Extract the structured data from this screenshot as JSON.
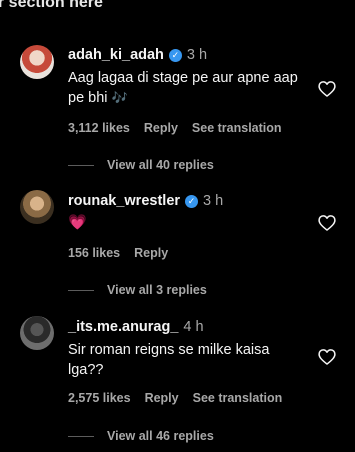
{
  "top_cut_text": "r section here",
  "comments": [
    {
      "username": "adah_ki_adah",
      "verified": true,
      "time": "3 h",
      "text": "Aag lagaa di stage pe aur apne aap pe bhi",
      "emoji": "🎶",
      "likes": "3,112 likes",
      "reply": "Reply",
      "see_translation": "See translation",
      "view_replies": "View all 40 replies",
      "like_icon": "heart-outline-icon"
    },
    {
      "username": "rounak_wrestler",
      "verified": true,
      "time": "3 h",
      "text": "",
      "emoji": "💗",
      "likes": "156 likes",
      "reply": "Reply",
      "view_replies": "View all 3 replies",
      "like_icon": "heart-outline-icon"
    },
    {
      "username": "_its.me.anurag_",
      "verified": false,
      "time": "4 h",
      "text": "Sir roman reigns se milke kaisa lga??",
      "emoji": "",
      "likes": "2,575 likes",
      "reply": "Reply",
      "see_translation": "See translation",
      "view_replies": "View all 46 replies",
      "like_icon": "heart-outline-icon"
    }
  ],
  "colors": {
    "background": "#000000",
    "text": "#f5f5f5",
    "muted": "#a8a8a8",
    "verified": "#3797f0",
    "heart_emoji": "#ff3040"
  }
}
